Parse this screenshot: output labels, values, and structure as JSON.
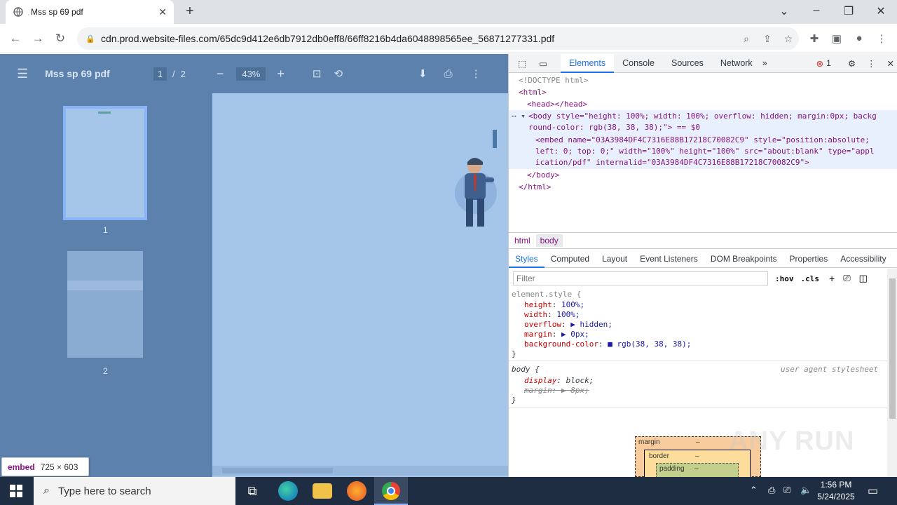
{
  "browser": {
    "tab_title": "Mss sp 69 pdf",
    "tab_close": "✕",
    "new_tab": "+",
    "url": "cdn.prod.website-files.com/65dc9d412e6db7912db0eff8/66ff8216b4da6048898565ee_56871277331.pdf"
  },
  "pdf": {
    "title": "Mss sp 69 pdf",
    "page_current": "1",
    "page_sep": "/",
    "page_total": "2",
    "zoom": "43%",
    "thumbs": [
      {
        "label": "1"
      },
      {
        "label": "2"
      }
    ]
  },
  "embed_tip": {
    "tag": "embed",
    "size": "725 × 603"
  },
  "devtools": {
    "tabs": [
      "Elements",
      "Console",
      "Sources",
      "Network"
    ],
    "error_count": "1",
    "dom": {
      "doctype": "<!DOCTYPE html>",
      "html_open": "<html>",
      "head": "<head></head>",
      "body_line1": "<body style=\"height: 100%; width: 100%; overflow: hidden; margin:0px; backg",
      "body_line2": "round-color: rgb(38, 38, 38);\"> == $0",
      "embed_line1": "<embed name=\"03A3984DF4C7316E88B17218C70082C9\" style=\"position:absolute;",
      "embed_line2": "left: 0; top: 0;\" width=\"100%\" height=\"100%\" src=\"about:blank\" type=\"appl",
      "embed_line3": "ication/pdf\" internalid=\"03A3984DF4C7316E88B17218C70082C9\">",
      "body_close": "</body>",
      "html_close": "</html>"
    },
    "crumbs": [
      "html",
      "body"
    ],
    "subtabs": [
      "Styles",
      "Computed",
      "Layout",
      "Event Listeners",
      "DOM Breakpoints",
      "Properties",
      "Accessibility"
    ],
    "filter_placeholder": "Filter",
    "hov": ":hov",
    "cls": ".cls",
    "element_style": {
      "selector": "element.style {",
      "props": [
        {
          "name": "height",
          "value": "100%;"
        },
        {
          "name": "width",
          "value": "100%;"
        },
        {
          "name": "overflow",
          "value": "▶ hidden;"
        },
        {
          "name": "margin",
          "value": "▶ 0px;"
        },
        {
          "name": "background-color",
          "value": "■ rgb(38, 38, 38);"
        }
      ],
      "close": "}"
    },
    "body_rule": {
      "selector": "body {",
      "source": "user agent stylesheet",
      "props": [
        {
          "name": "display",
          "value": "block;"
        },
        {
          "name": "margin",
          "value": "▶ 8px;"
        }
      ],
      "close": "}"
    },
    "boxmodel": {
      "margin": "margin",
      "margin_val": "–",
      "border": "border",
      "border_val": "–",
      "padding": "padding",
      "padding_val": "–"
    }
  },
  "taskbar": {
    "search_placeholder": "Type here to search",
    "time": "1:56 PM",
    "date": "5/24/2025"
  },
  "watermark": "ANY RUN",
  "colors": {
    "pdf_bg": "#a5c5e9",
    "pdf_bar": "#5c81ad",
    "accent": "#1a73e8",
    "taskbar": "#1f2d43"
  }
}
